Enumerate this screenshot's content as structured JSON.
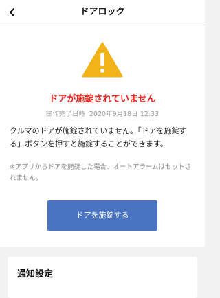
{
  "header": {
    "title": "ドアロック",
    "back_icon": "chevron-left-icon"
  },
  "alert": {
    "icon": "warning-triangle-icon",
    "title": "ドアが施錠されていません",
    "timestamp_label": "操作完了日時",
    "timestamp_value": "2020年9月18日 12:33",
    "description": "クルマのドアが施錠されていません。「ドアを施錠する」ボタンを押すと施錠することができます。",
    "note": "※アプリからドアを施錠した場合、オートアラームはセットされません。",
    "colors": {
      "warning": "#f2b21a",
      "alert_text": "#e8241c",
      "button": "#4a74c2"
    }
  },
  "actions": {
    "lock_button_label": "ドアを施錠する"
  },
  "notification_settings": {
    "title": "通知設定"
  }
}
